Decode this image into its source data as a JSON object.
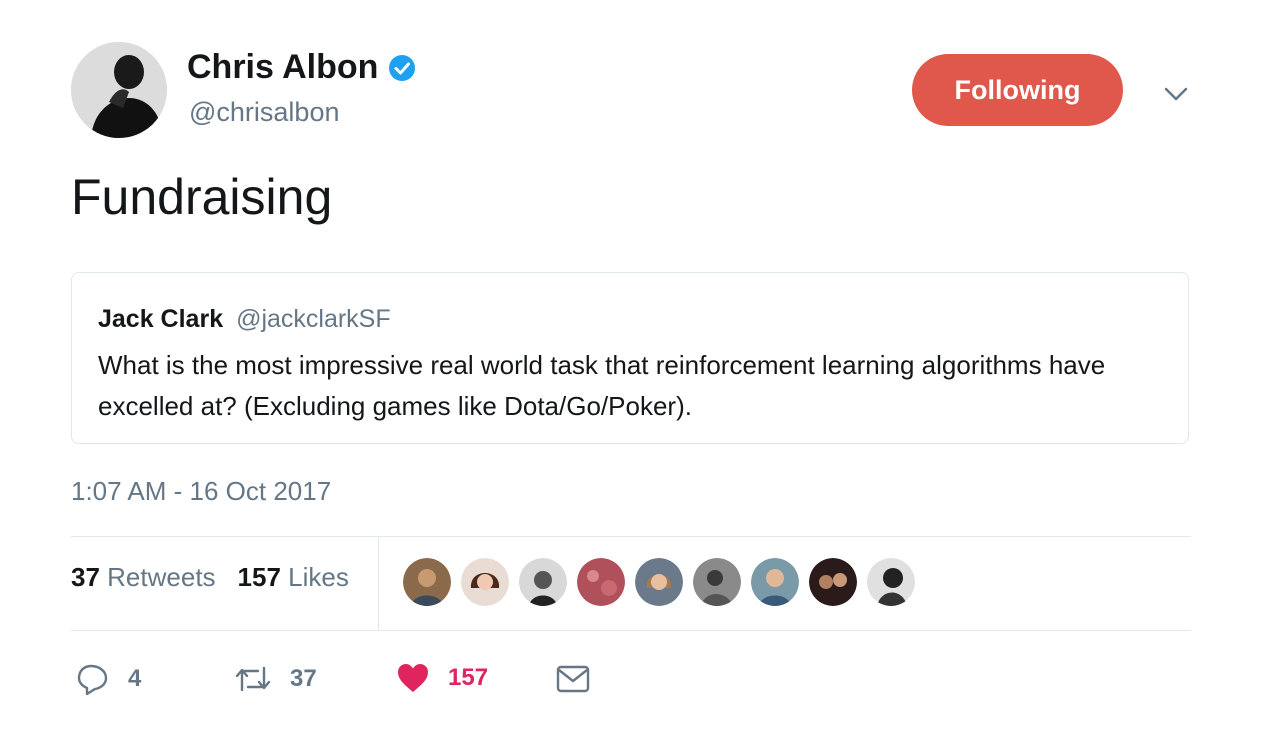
{
  "author": {
    "name": "Chris Albon",
    "handle": "@chrisalbon",
    "verified": true
  },
  "follow_button": {
    "label": "Following",
    "color": "#e0584b"
  },
  "tweet": {
    "text": "Fundraising"
  },
  "quoted_tweet": {
    "name": "Jack Clark",
    "handle": "@jackclarkSF",
    "text": "What is the most impressive real world task that reinforcement learning algorithms have excelled at? (Excluding games like Dota/Go/Poker)."
  },
  "timestamp": "1:07 AM - 16 Oct 2017",
  "stats": {
    "retweets_count": "37",
    "retweets_label": "Retweets",
    "likes_count": "157",
    "likes_label": "Likes"
  },
  "liker_avatars": 9,
  "actions": {
    "reply_count": "4",
    "retweet_count": "37",
    "like_count": "157"
  },
  "colors": {
    "verified": "#1da1f2",
    "like": "#e0245e",
    "secondary_text": "#657786"
  }
}
